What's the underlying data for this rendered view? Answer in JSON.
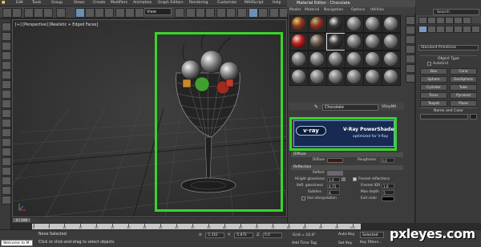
{
  "menubar": {
    "items": [
      "Edit",
      "Tools",
      "Group",
      "Views",
      "Create",
      "Modifiers",
      "Animation",
      "Graph Editors",
      "Rendering",
      "Customize",
      "MAXScript",
      "Help"
    ]
  },
  "toolbar": {
    "view_dropdown": "View"
  },
  "viewport": {
    "label": "[+] [Perspective] [Realistic + Edged Faces]"
  },
  "material_editor": {
    "title": "Material Editor - Chocolate",
    "menu": [
      "Modes",
      "Material",
      "Navigation",
      "Options",
      "Utilities"
    ],
    "material_name": "Chocolate",
    "material_type": "VRayMtl",
    "banner": {
      "logo": "v·ray",
      "title": "V-Ray PowerShader",
      "subtitle": "optimized for V-Ray"
    },
    "params": {
      "diffuse_header": "Diffuse",
      "diffuse_label": "Diffuse",
      "roughness_label": "Roughness",
      "roughness_value": "0.0",
      "reflection_header": "Reflection",
      "reflect_label": "Reflect",
      "hilight_gloss_label": "Hilight glossiness",
      "hilight_gloss_value": "1.0",
      "fresnel_label": "Fresnel reflections",
      "refl_gloss_label": "Refl. glossiness",
      "refl_gloss_value": "0.75",
      "fresnel_ior_label": "Fresnel IOR",
      "fresnel_ior_value": "1.6",
      "subdivs_label": "Subdivs",
      "subdivs_value": "8",
      "max_depth_label": "Max depth",
      "max_depth_value": "5",
      "use_interp_label": "Use interpolation",
      "exit_color_label": "Exit color"
    }
  },
  "command_panel": {
    "search_placeholder": "Search",
    "dropdown": "Standard Primitives",
    "object_type_header": "Object Type",
    "autogrid": "AutoGrid",
    "objects": [
      "Box",
      "Cone",
      "Sphere",
      "GeoSphere",
      "Cylinder",
      "Tube",
      "Torus",
      "Pyramid",
      "Teapot",
      "Plane"
    ],
    "name_color_header": "Name and Color"
  },
  "timeline": {
    "slider": "0 / 100",
    "ticks": [
      "0",
      "5",
      "10",
      "15",
      "20",
      "25",
      "30",
      "35",
      "40",
      "45",
      "50",
      "55",
      "60",
      "65",
      "70",
      "75",
      "80",
      "85",
      "90",
      "95",
      "100"
    ]
  },
  "status": {
    "welcome": "Welcome to M:",
    "none_selected": "None Selected",
    "hint": "Click or click-and-drag to select objects",
    "x_label": "X:",
    "y_label": "Y:",
    "z_label": "Z:",
    "x_value": "-1.31E",
    "y_value": "-5.87E",
    "z_value": "0.0",
    "grid": "Grid = 10.0\"",
    "add_time_tag": "Add Time Tag",
    "auto_key": "Auto Key",
    "set_key": "Set Key",
    "selected": "Selected",
    "key_filters": "Key Filters..."
  },
  "watermark": "pxleyes.com",
  "colors": {
    "highlight": "#39d42a",
    "vray_blue": "#162a52"
  }
}
